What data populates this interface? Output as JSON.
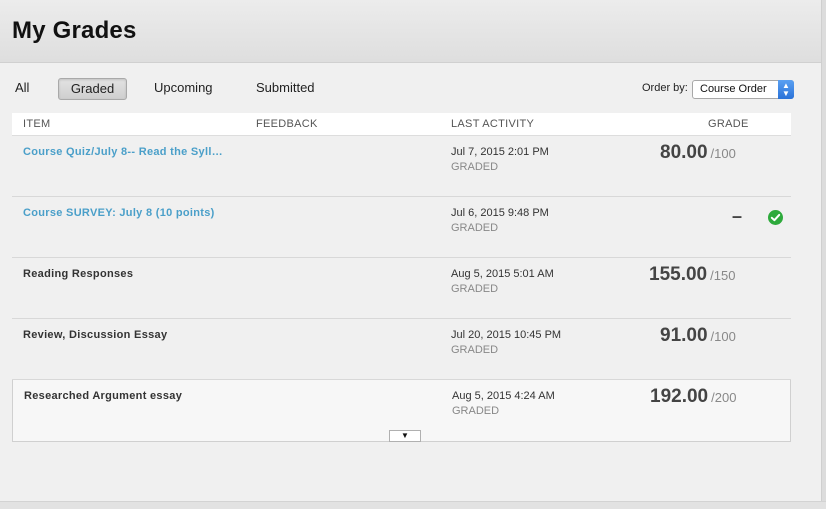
{
  "page": {
    "title": "My Grades"
  },
  "filters": {
    "all": "All",
    "graded": "Graded",
    "upcoming": "Upcoming",
    "submitted": "Submitted",
    "selected": "Graded"
  },
  "order_by": {
    "label": "Order by:",
    "value": "Course Order"
  },
  "table": {
    "headers": {
      "item": "ITEM",
      "feedback": "FEEDBACK",
      "last_activity": "LAST ACTIVITY",
      "grade": "GRADE"
    },
    "rows": [
      {
        "item": "Course Quiz/July 8-- Read the Syll…",
        "date": "Jul 7, 2015 2:01 PM",
        "status": "GRADED",
        "score": "80.00",
        "total": "/100"
      },
      {
        "item": "Course SURVEY: July 8 (10 points)",
        "date": "Jul 6, 2015 9:48 PM",
        "status": "GRADED",
        "score": "–",
        "total": "",
        "icon": "check-circle-icon",
        "icon_color": "#2eaa3c"
      },
      {
        "item": "Reading Responses",
        "date": "Aug 5, 2015 5:01 AM",
        "status": "GRADED",
        "score": "155.00",
        "total": "/150"
      },
      {
        "item": "Review, Discussion Essay",
        "date": "Jul 20, 2015 10:45 PM",
        "status": "GRADED",
        "score": "91.00",
        "total": "/100"
      },
      {
        "item": "Researched Argument essay",
        "date": "Aug 5, 2015 4:24 AM",
        "status": "GRADED",
        "score": "192.00",
        "total": "/200"
      }
    ]
  },
  "colors": {
    "link": "#4a9fc9",
    "accent": "#2a72d8"
  }
}
